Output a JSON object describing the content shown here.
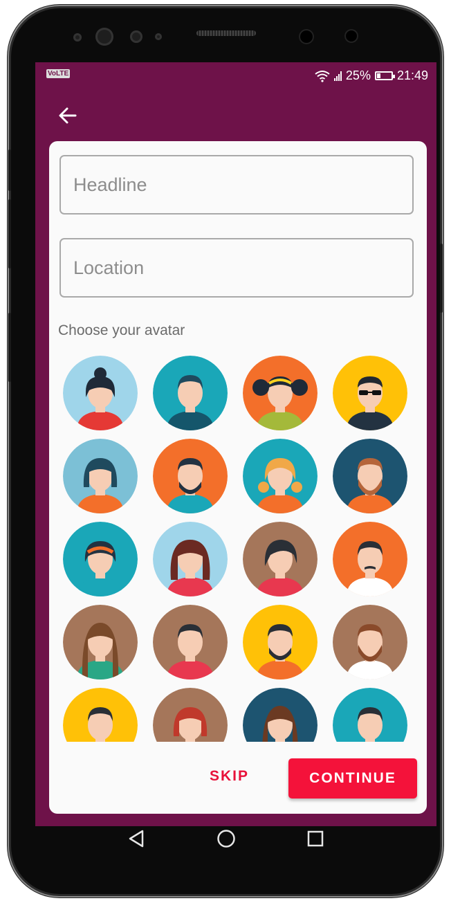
{
  "status_bar": {
    "volte": "VoLTE",
    "battery_text": "25%",
    "time": "21:49",
    "battery_level": 0.25
  },
  "header": {
    "back_icon": "arrow-left-icon"
  },
  "form": {
    "headline_placeholder": "Headline",
    "headline_value": "",
    "location_placeholder": "Location",
    "location_value": "",
    "avatar_heading": "Choose your avatar"
  },
  "avatars": [
    {
      "bg": "#9fd5ea",
      "skin": "#f6cdb4",
      "hair": "#1f2a38",
      "shirt": "#e53935",
      "style": "bun-woman"
    },
    {
      "bg": "#1aa7b8",
      "skin": "#f6cdb4",
      "hair": "#1f4a5e",
      "shirt": "#15566b",
      "style": "short-man"
    },
    {
      "bg": "#f36f2a",
      "skin": "#f6cdb4",
      "hair": "#1f2a38",
      "shirt": "#a4b93a",
      "style": "pigtails-girl"
    },
    {
      "bg": "#ffc107",
      "skin": "#f6cdb4",
      "hair": "#222831",
      "shirt": "#233241",
      "style": "sunglasses-man"
    },
    {
      "bg": "#7cc0d6",
      "skin": "#f6cdb4",
      "hair": "#1f4a5e",
      "shirt": "#f36f2a",
      "style": "bob-woman"
    },
    {
      "bg": "#f36f2a",
      "skin": "#f6cdb4",
      "hair": "#233241",
      "shirt": "#1aa7b8",
      "style": "beard-man"
    },
    {
      "bg": "#1aa7b8",
      "skin": "#f6cdb4",
      "hair": "#f0a848",
      "shirt": "#f36f2a",
      "style": "blonde-girl"
    },
    {
      "bg": "#1d5470",
      "skin": "#f6cdb4",
      "hair": "#b5653a",
      "shirt": "#f36f2a",
      "style": "ginger-beard-man"
    },
    {
      "bg": "#1aa7b8",
      "skin": "#f6cdb4",
      "hair": "#233241",
      "shirt": "#1aa7b8",
      "style": "headband-woman"
    },
    {
      "bg": "#9fd5ea",
      "skin": "#f6cdb4",
      "hair": "#6b2a22",
      "shirt": "#e8384f",
      "style": "curly-woman"
    },
    {
      "bg": "#a5765a",
      "skin": "#f6cdb4",
      "hair": "#2a2f36",
      "shirt": "#e8384f",
      "style": "dark-hair-woman"
    },
    {
      "bg": "#f36f2a",
      "skin": "#f6cdb4",
      "hair": "#2a2f36",
      "shirt": "#ffffff",
      "style": "mustache-man"
    },
    {
      "bg": "#a5765a",
      "skin": "#f6cdb4",
      "hair": "#7a4a2a",
      "shirt": "#2aa786",
      "style": "long-hair-woman"
    },
    {
      "bg": "#a5765a",
      "skin": "#f6cdb4",
      "hair": "#2a2f36",
      "shirt": "#e8384f",
      "style": "short-man"
    },
    {
      "bg": "#ffc107",
      "skin": "#f6cdb4",
      "hair": "#2a2f36",
      "shirt": "#f36f2a",
      "style": "beard-man"
    },
    {
      "bg": "#a5765a",
      "skin": "#f6cdb4",
      "hair": "#8a4a2a",
      "shirt": "#ffffff",
      "style": "ginger-beard-man"
    },
    {
      "bg": "#ffc107",
      "skin": "#f6cdb4",
      "hair": "#2a2f36",
      "shirt": "#1aa7b8",
      "style": "short-man"
    },
    {
      "bg": "#a5765a",
      "skin": "#f6cdb4",
      "hair": "#c0392b",
      "shirt": "#e8384f",
      "style": "bob-woman"
    },
    {
      "bg": "#1d5470",
      "skin": "#f6cdb4",
      "hair": "#6b3a22",
      "shirt": "#f36f2a",
      "style": "long-hair-woman"
    },
    {
      "bg": "#1aa7b8",
      "skin": "#f6cdb4",
      "hair": "#2a2f36",
      "shirt": "#233241",
      "style": "short-man"
    }
  ],
  "actions": {
    "skip_label": "SKIP",
    "continue_label": "CONTINUE"
  },
  "nav": {
    "back_icon": "triangle-back-icon",
    "home_icon": "circle-home-icon",
    "recents_icon": "square-recents-icon"
  },
  "colors": {
    "primary": "#6e1249",
    "accent": "#f4123a"
  }
}
